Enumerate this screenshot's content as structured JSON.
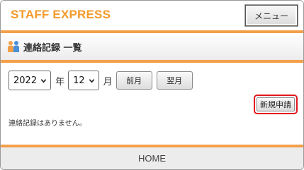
{
  "header": {
    "app_title": "STAFF EXPRESS",
    "menu_label": "メニュー",
    "accent_color": "#f4a04a"
  },
  "section": {
    "title": "連絡記録 一覧",
    "icon": "people-icon"
  },
  "filters": {
    "year_value": "2022",
    "year_unit": "年",
    "month_value": "12",
    "month_unit": "月",
    "prev_label": "前月",
    "next_label": "翌月"
  },
  "actions": {
    "new_request_label": "新規申請",
    "highlight_color": "#e3171c"
  },
  "content": {
    "empty_message": "連絡記録はありません。"
  },
  "footer": {
    "home_label": "HOME"
  }
}
